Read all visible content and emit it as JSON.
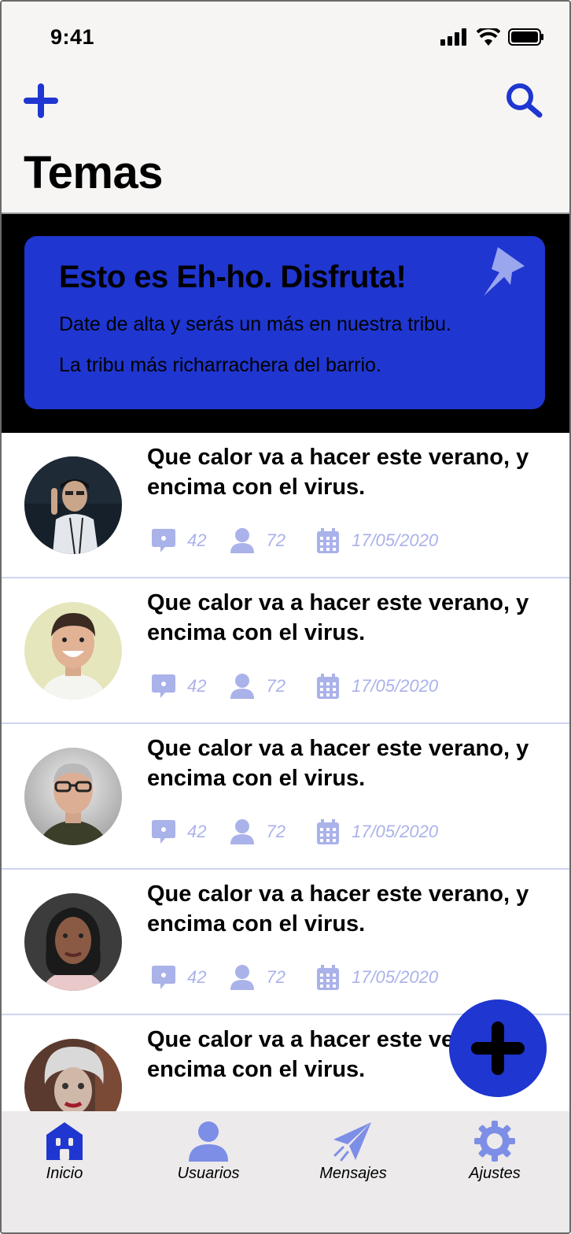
{
  "status_bar": {
    "time": "9:41"
  },
  "header": {
    "title": "Temas"
  },
  "banner": {
    "title": "Esto es Eh-ho. Disfruta!",
    "line1": "Date de alta y serás un más en nuestra tribu.",
    "line2": "La tribu más richarrachera del barrio."
  },
  "topics": [
    {
      "title": "Que calor va a hacer este verano, y encima con el virus.",
      "replies": "42",
      "users": "72",
      "date": "17/05/2020"
    },
    {
      "title": "Que calor va a hacer este verano, y encima con el virus.",
      "replies": "42",
      "users": "72",
      "date": "17/05/2020"
    },
    {
      "title": "Que calor va a hacer este verano, y encima con el virus.",
      "replies": "42",
      "users": "72",
      "date": "17/05/2020"
    },
    {
      "title": "Que calor va a hacer este verano, y encima con el virus.",
      "replies": "42",
      "users": "72",
      "date": "17/05/2020"
    },
    {
      "title": "Que calor va a hacer este verano, y encima con el virus."
    }
  ],
  "tab_bar": {
    "items": [
      {
        "label": "Inicio",
        "icon": "home-icon",
        "active": true
      },
      {
        "label": "Usuarios",
        "icon": "user-icon"
      },
      {
        "label": "Mensajes",
        "icon": "paper-plane-icon"
      },
      {
        "label": "Ajustes",
        "icon": "gear-icon"
      }
    ]
  },
  "colors": {
    "accent": "#1f36d0",
    "meta": "#aab2ea",
    "tab_inactive": "#7d8ee6",
    "header_bg": "#f6f5f4"
  }
}
